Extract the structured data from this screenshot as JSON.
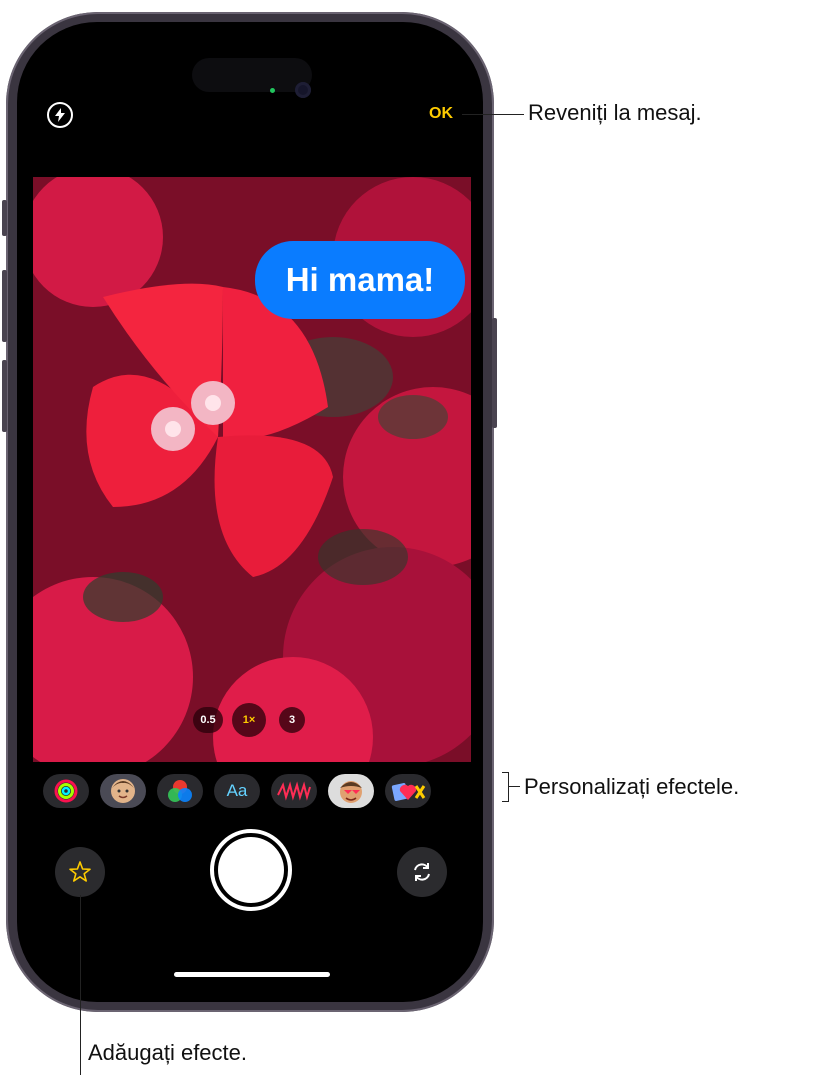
{
  "camera": {
    "done_label": "OK",
    "message_sticker": "Hi mama!",
    "zoom_options": [
      "0.5",
      "1×",
      "3"
    ],
    "selected_zoom": "1×"
  },
  "effects_strip": {
    "items": [
      {
        "name": "fitness",
        "icon": "activity-rings-icon"
      },
      {
        "name": "memoji",
        "icon": "memoji-icon"
      },
      {
        "name": "filters",
        "icon": "filters-icon"
      },
      {
        "name": "text",
        "icon": "text-label",
        "label": "Aa"
      },
      {
        "name": "shapes",
        "icon": "scribble-icon"
      },
      {
        "name": "memoji-stickers",
        "icon": "emoji-sticker-icon"
      },
      {
        "name": "stickers",
        "icon": "heart-sticker-icon"
      }
    ]
  },
  "callouts": {
    "done": "Reveniți la mesaj.",
    "customize": "Personalizați efectele.",
    "add_effects": "Adăugați efecte."
  },
  "colors": {
    "accent": "#ffcc00",
    "bubble": "#0a7cff",
    "screen": "#000000"
  }
}
